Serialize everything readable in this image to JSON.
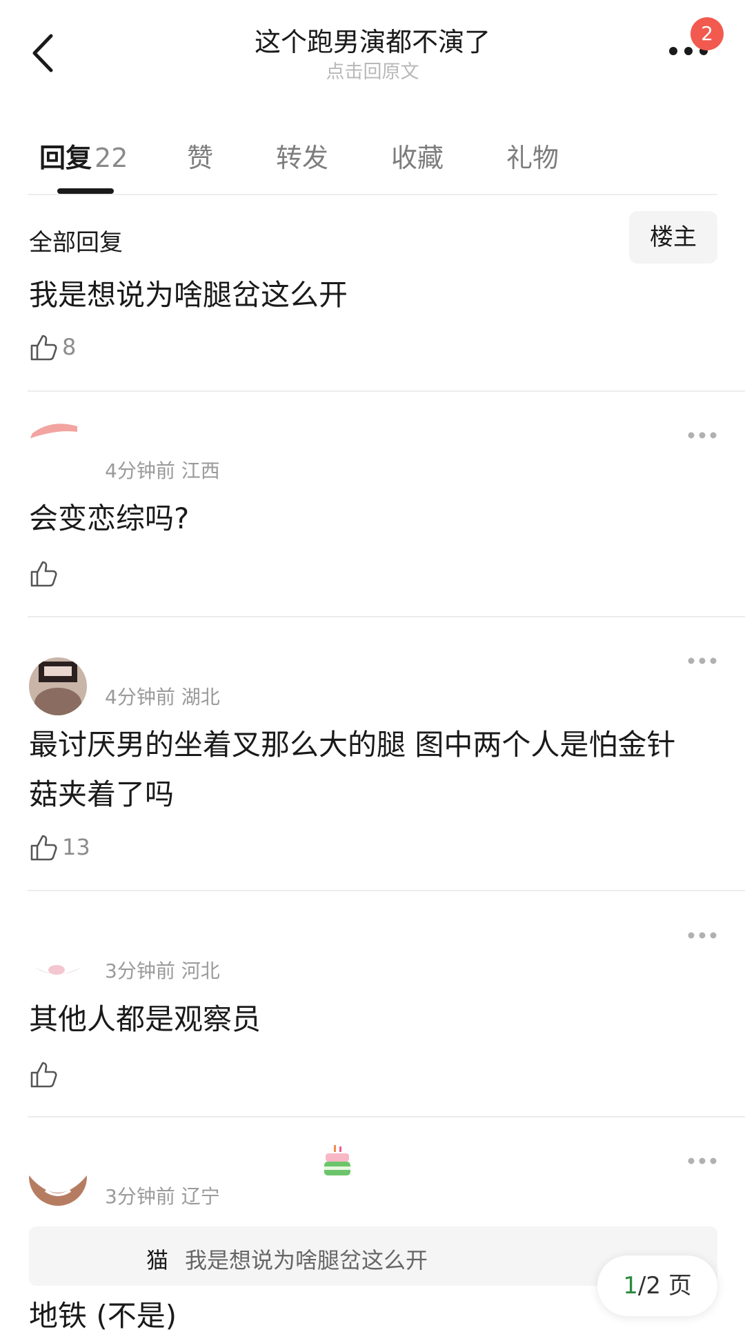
{
  "header": {
    "title": "这个跑男演都不演了",
    "subtitle": "点击回原文",
    "badge_count": "2"
  },
  "tabs": [
    {
      "label": "回复",
      "count": "22",
      "active": true
    },
    {
      "label": "赞"
    },
    {
      "label": "转发"
    },
    {
      "label": "收藏"
    },
    {
      "label": "礼物"
    }
  ],
  "section": {
    "all_replies_label": "全部回复",
    "owner_button_label": "楼主"
  },
  "first_comment": {
    "text": "我是想说为啥腿岔这么开",
    "likes": "8"
  },
  "comments": [
    {
      "meta": "4分钟前 江西",
      "text": "会变恋综吗?",
      "likes": ""
    },
    {
      "meta": "4分钟前 湖北",
      "text_line1": "最讨厌男的坐着叉那么大的腿 图中两个人是怕金针",
      "text_line2": "菇夹着了吗",
      "likes": "13"
    },
    {
      "meta": "3分钟前 河北",
      "text": "其他人都是观察员",
      "likes": ""
    },
    {
      "meta": "3分钟前 辽宁",
      "quote_name": "猫",
      "quote_text": "我是想说为啥腿岔这么开",
      "text": "地铁 (不是)"
    }
  ],
  "pagination": {
    "current": "1",
    "total_label": "/2 页"
  },
  "icons": {
    "back": "chevron-left-icon",
    "more": "more-horizontal-icon",
    "like": "thumbs-up-icon",
    "cake": "cake-icon"
  },
  "colors": {
    "badge": "#f25a4f",
    "page_current": "#2a8a3e"
  }
}
